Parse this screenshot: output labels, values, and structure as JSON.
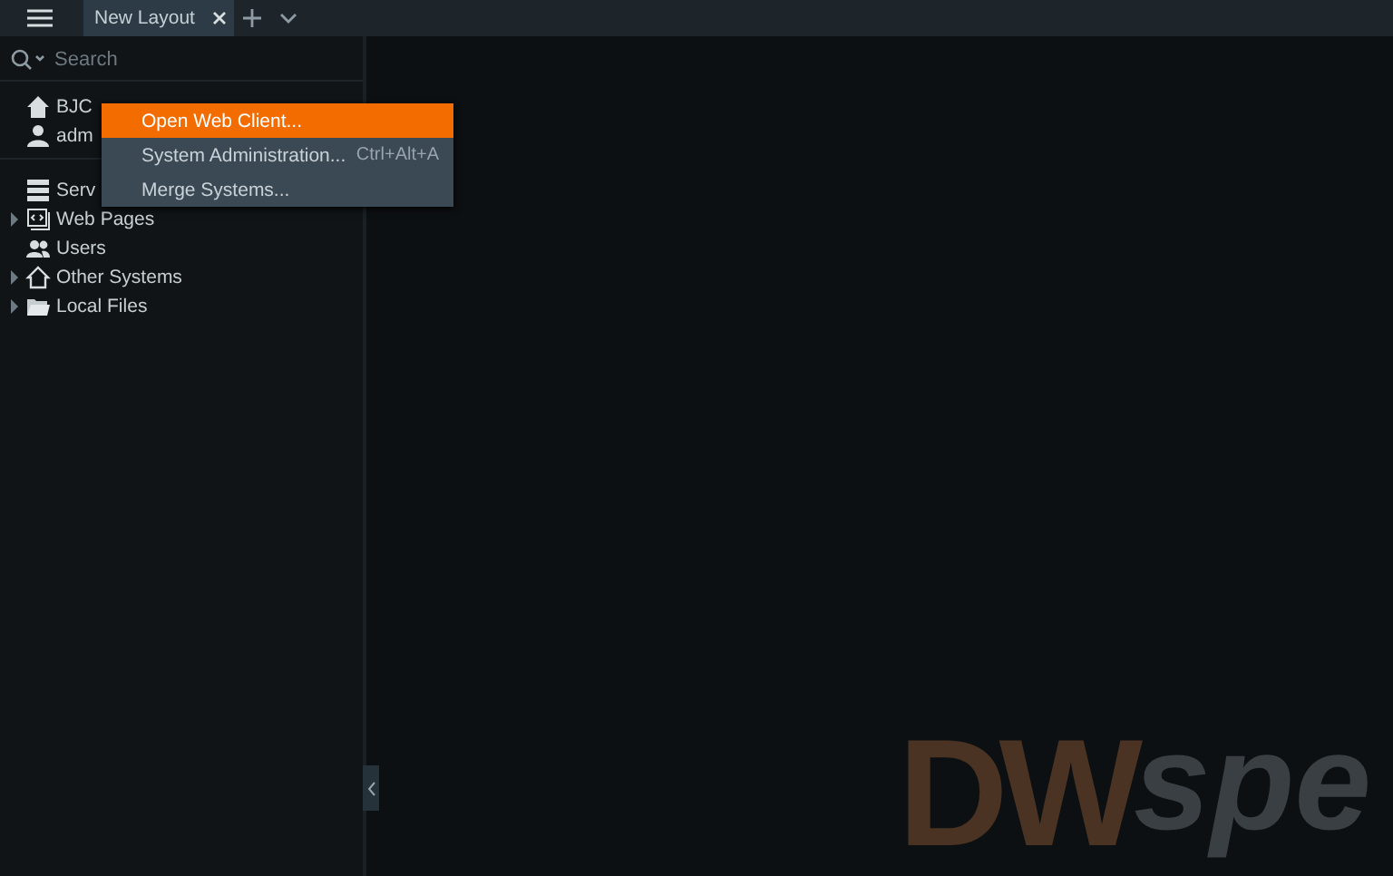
{
  "tabs": [
    {
      "label": "New Layout",
      "selected": true
    }
  ],
  "search": {
    "placeholder": "Search"
  },
  "tree": {
    "sections": [
      [
        {
          "kind": "system",
          "label": "BJC",
          "expandable": false
        },
        {
          "kind": "user",
          "label": "adm",
          "expandable": false
        }
      ],
      [
        {
          "kind": "servers",
          "label": "Serv",
          "expandable": false
        },
        {
          "kind": "webpages",
          "label": "Web Pages",
          "expandable": true
        },
        {
          "kind": "users",
          "label": "Users",
          "expandable": false
        },
        {
          "kind": "remote",
          "label": "Other Systems",
          "expandable": true
        },
        {
          "kind": "files",
          "label": "Local Files",
          "expandable": true
        }
      ]
    ]
  },
  "context_menu": {
    "items": [
      {
        "label": "Open Web Client...",
        "selected": true
      },
      {
        "label": "System Administration...",
        "shortcut": "Ctrl+Alt+A",
        "selected": false
      },
      {
        "label": "Merge Systems...",
        "selected": false
      }
    ]
  },
  "background_logo": {
    "mark": "DW",
    "text": "spe"
  }
}
